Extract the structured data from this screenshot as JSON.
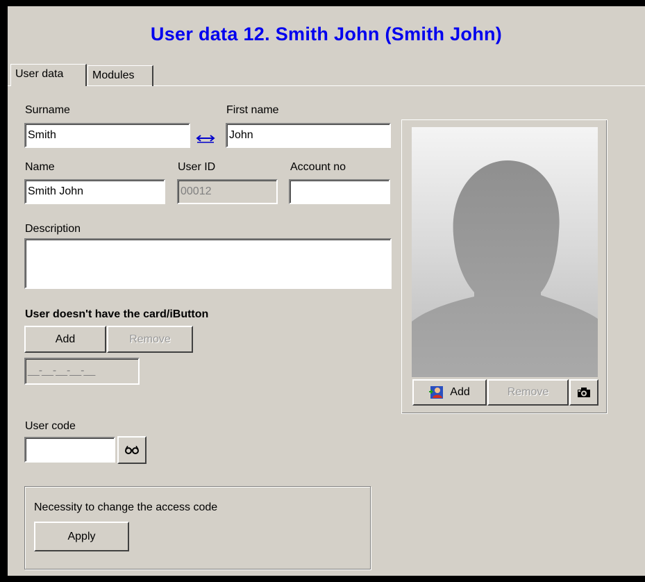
{
  "window": {
    "title": "User data 12.  Smith John  (Smith John)"
  },
  "tabs": [
    {
      "label": "User data",
      "active": true
    },
    {
      "label": "Modules",
      "active": false
    }
  ],
  "fields": {
    "surname": {
      "label": "Surname",
      "value": "Smith"
    },
    "first_name": {
      "label": "First name",
      "value": "John"
    },
    "name": {
      "label": "Name",
      "value": "Smith John"
    },
    "user_id": {
      "label": "User ID",
      "value": "00012"
    },
    "account_no": {
      "label": "Account no",
      "value": ""
    },
    "description": {
      "label": "Description",
      "value": ""
    }
  },
  "card": {
    "status": "User doesn't have the card/iButton",
    "add_label": "Add",
    "remove_label": "Remove",
    "code_value": "__-__-__-__-__"
  },
  "photo": {
    "add_label": "Add",
    "remove_label": "Remove",
    "camera_icon": "camera-icon",
    "add_icon": "person-add-icon"
  },
  "user_code": {
    "label": "User code",
    "value": "",
    "reveal_icon": "glasses-icon"
  },
  "access_code": {
    "label": "Necessity to change the access code",
    "apply_label": "Apply"
  },
  "colors": {
    "title": "#0000ee",
    "window_bg": "#d4d0c8"
  }
}
